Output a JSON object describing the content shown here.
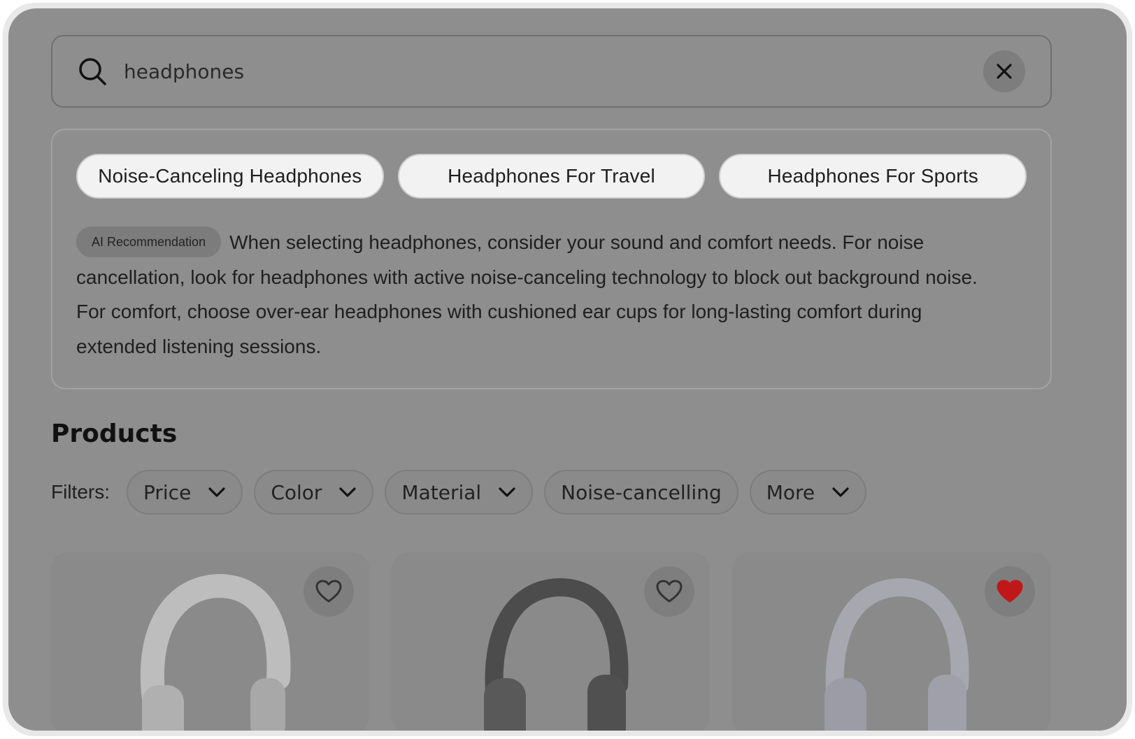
{
  "search": {
    "value": "headphones",
    "placeholder": "Search",
    "clear_icon": "close-icon",
    "search_icon": "search-icon"
  },
  "suggestions": {
    "chips": [
      {
        "label": "Noise-Canceling Headphones"
      },
      {
        "label": "Headphones For Travel"
      },
      {
        "label": "Headphones For Sports"
      }
    ],
    "ai_badge": "AI Recommendation",
    "recommendation": "When selecting headphones, consider your sound and comfort needs. For noise cancellation, look for headphones with active noise-canceling technology to block out background noise. For comfort, choose over-ear headphones with cushioned ear cups for long-lasting comfort during extended listening sessions."
  },
  "products": {
    "title": "Products",
    "filters_label": "Filters:",
    "filters": [
      {
        "label": "Price",
        "has_dropdown": true
      },
      {
        "label": "Color",
        "has_dropdown": true
      },
      {
        "label": "Material",
        "has_dropdown": true
      },
      {
        "label": "Noise-cancelling",
        "has_dropdown": false
      },
      {
        "label": "More",
        "has_dropdown": true
      }
    ],
    "items": [
      {
        "favorited": false,
        "color": "#bdbdbd"
      },
      {
        "favorited": false,
        "color": "#4a4a4a"
      },
      {
        "favorited": true,
        "color": "#a7a7b0"
      }
    ]
  },
  "colors": {
    "overlay": "#8e8e8e",
    "favorite_active": "#c01818"
  }
}
